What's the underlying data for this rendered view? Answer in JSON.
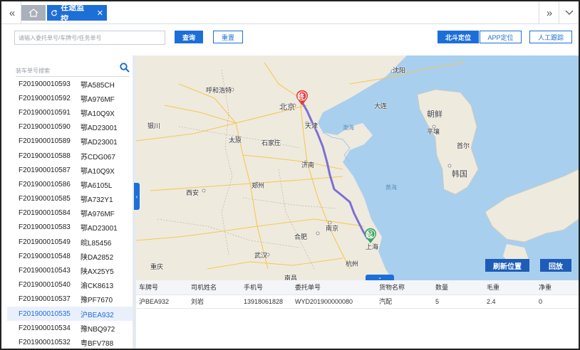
{
  "tabs": {
    "active_label": "在途监控",
    "close_symbol": "✕"
  },
  "filter": {
    "search_placeholder": "请输入委托单号/车牌号/任务单号",
    "query_label": "查询",
    "reset_label": "重置",
    "beidou_label": "北斗定位",
    "app_label": "APP定位",
    "manual_label": "人工跟踪"
  },
  "left": {
    "search_placeholder": "装车单号搜索",
    "items": [
      {
        "id": "F201900010593",
        "plate": "鄂A585CH",
        "selected": false
      },
      {
        "id": "F201900010592",
        "plate": "鄂A976MF",
        "selected": false
      },
      {
        "id": "F201900010591",
        "plate": "鄂A10Q9X",
        "selected": false
      },
      {
        "id": "F201900010590",
        "plate": "鄂AD23001",
        "selected": false
      },
      {
        "id": "F201900010589",
        "plate": "鄂AD23001",
        "selected": false
      },
      {
        "id": "F201900010588",
        "plate": "苏CDG067",
        "selected": false
      },
      {
        "id": "F201900010587",
        "plate": "鄂A10Q9X",
        "selected": false
      },
      {
        "id": "F201900010586",
        "plate": "鄂A6105L",
        "selected": false
      },
      {
        "id": "F201900010585",
        "plate": "鄂A732Y1",
        "selected": false
      },
      {
        "id": "F201900010584",
        "plate": "鄂A976MF",
        "selected": false
      },
      {
        "id": "F201900010583",
        "plate": "鄂AD23001",
        "selected": false
      },
      {
        "id": "F201900010549",
        "plate": "皖L85456",
        "selected": false
      },
      {
        "id": "F201900010548",
        "plate": "陕DA2852",
        "selected": false
      },
      {
        "id": "F201900010543",
        "plate": "陕AX25Y5",
        "selected": false
      },
      {
        "id": "F201900010540",
        "plate": "渝CK8613",
        "selected": false
      },
      {
        "id": "F201900010537",
        "plate": "豫PF7670",
        "selected": false
      },
      {
        "id": "F201900010535",
        "plate": "沪BEA932",
        "selected": true
      },
      {
        "id": "F201900010534",
        "plate": "豫NBQ972",
        "selected": false
      },
      {
        "id": "F201900010532",
        "plate": "粤BFV788",
        "selected": false
      }
    ]
  },
  "map": {
    "refresh_label": "刷新位置",
    "replay_label": "回放",
    "start_marker": "起",
    "end_marker": "终",
    "labels": {
      "beijing": "北京",
      "tianjin": "天津",
      "huhehaote": "呼和浩特",
      "shenyang": "沈阳",
      "dalian": "大连",
      "taiyuan": "太原",
      "shijiazhuang": "石家庄",
      "jinan": "济南",
      "zhengzhou": "郑州",
      "xian": "西安",
      "hefei": "合肥",
      "nanjing": "南京",
      "shanghai": "上海",
      "hangzhou": "杭州",
      "wuhan": "武汉",
      "nanchang": "南昌",
      "chongqing": "重庆",
      "yinchuan": "银川",
      "chaoxian": "朝鲜",
      "hanguo": "韩国",
      "pingrang": "平壤",
      "shouer": "首尔",
      "huanghai": "黄海",
      "bohai": "渤海"
    }
  },
  "table": {
    "headers": [
      "车牌号",
      "司机姓名",
      "手机号",
      "委托单号",
      "货物名称",
      "数量",
      "毛重",
      "净重"
    ],
    "row": [
      "沪BEA932",
      "刘岩",
      "13918061828",
      "WYD201900000080",
      "汽配",
      "5",
      "2.4",
      "0"
    ]
  },
  "colors": {
    "accent": "#1d6fd8",
    "route": "#7b6fd6",
    "sea": "#a9cfee",
    "land": "#efeade"
  }
}
